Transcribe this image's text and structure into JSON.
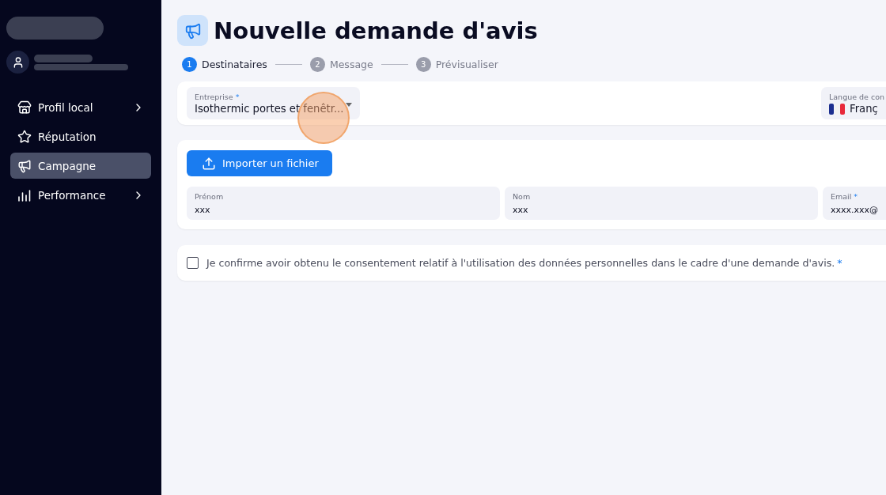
{
  "sidebar": {
    "items": [
      {
        "label": "Profil local",
        "selected": false,
        "has_submenu": true
      },
      {
        "label": "Réputation",
        "selected": false,
        "has_submenu": false
      },
      {
        "label": "Campagne",
        "selected": true,
        "has_submenu": false
      },
      {
        "label": "Performance",
        "selected": false,
        "has_submenu": true
      }
    ]
  },
  "page": {
    "title": "Nouvelle demande d'avis"
  },
  "steps": [
    {
      "number": "1",
      "label": "Destinataires",
      "selected": true
    },
    {
      "number": "2",
      "label": "Message",
      "selected": false
    },
    {
      "number": "3",
      "label": "Prévisualiser",
      "selected": false
    }
  ],
  "settings": {
    "company": {
      "label": "Entreprise",
      "required_mark": "*",
      "value": "Isothermic portes et fenêtr..."
    },
    "language": {
      "label": "Langue de con",
      "value": "Franç"
    }
  },
  "recipients": {
    "import_button": "Importer un fichier",
    "fields": [
      {
        "label": "Prénom",
        "value": "xxx"
      },
      {
        "label": "Nom",
        "value": "xxx"
      },
      {
        "label": "Email",
        "required_mark": "*",
        "value": "xxxx.xxx@"
      }
    ]
  },
  "consent": {
    "text": "Je confirme avoir obtenu le consentement relatif à l'utilisation des données personnelles dans le cadre d'une demande d'avis.",
    "required_mark": "*",
    "checked": false
  }
}
